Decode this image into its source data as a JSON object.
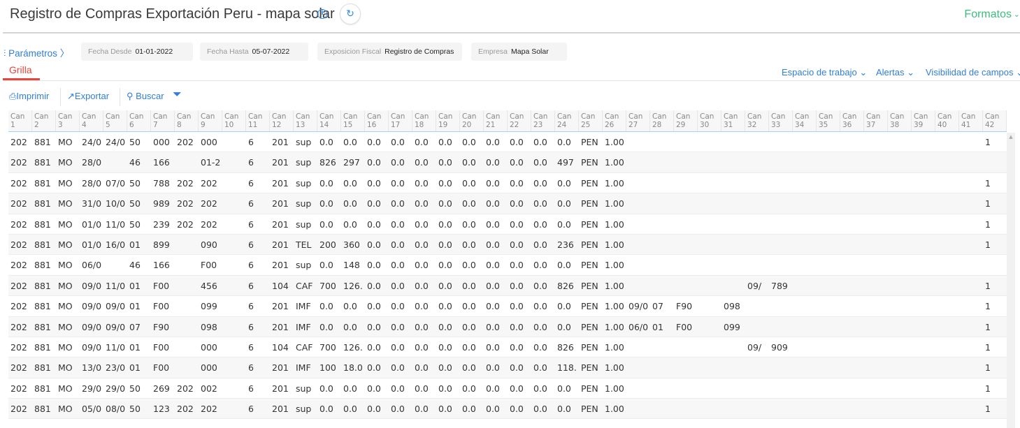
{
  "header": {
    "title": "Registro de Compras Exportación Peru - mapa solar",
    "formatos": "Formatos"
  },
  "params": {
    "label": "Parámetros",
    "chips": [
      {
        "key": "Fecha Desde",
        "value": "01-01-2022"
      },
      {
        "key": "Fecha Hasta",
        "value": "05-07-2022"
      },
      {
        "key": "Exposicion Fiscal",
        "value": "Registro de Compras"
      },
      {
        "key": "Empresa",
        "value": "Mapa Solar"
      }
    ]
  },
  "tabs": {
    "active": "Grilla"
  },
  "links": {
    "workspace": "Espacio de trabajo",
    "alerts": "Alertas",
    "visibility": "Visibilidad de campos"
  },
  "toolbar": {
    "print": "Imprimir",
    "export": "Exportar",
    "search": "Buscar"
  },
  "grid": {
    "header_prefix": "Can",
    "rows": [
      [
        "202",
        "881",
        "MO",
        "24/0",
        "24/0",
        "50",
        "000",
        "202",
        "000",
        "",
        "6",
        "201",
        "sup",
        "0.0",
        "0.0",
        "0.0",
        "0.0",
        "0.0",
        "0.0",
        "0.0",
        "0.0",
        "0.0",
        "0.0",
        "0.0",
        "PEN",
        "1.00",
        "",
        "",
        "",
        "",
        "",
        "",
        "",
        "",
        "",
        "",
        "",
        "",
        "",
        "",
        "",
        "1"
      ],
      [
        "202",
        "881",
        "MO",
        "28/0",
        "",
        "46",
        "166",
        "",
        "01-2",
        "",
        "6",
        "201",
        "sup",
        "826",
        "297",
        "0.0",
        "0.0",
        "0.0",
        "0.0",
        "0.0",
        "0.0",
        "0.0",
        "0.0",
        "497",
        "PEN",
        "1.00",
        "",
        "",
        "",
        "",
        "",
        "",
        "",
        "",
        "",
        "",
        "",
        "",
        "",
        "",
        "",
        ""
      ],
      [
        "202",
        "881",
        "MO",
        "28/0",
        "07/0",
        "50",
        "788",
        "202",
        "202",
        "",
        "6",
        "201",
        "sup",
        "0.0",
        "0.0",
        "0.0",
        "0.0",
        "0.0",
        "0.0",
        "0.0",
        "0.0",
        "0.0",
        "0.0",
        "0.0",
        "PEN",
        "1.00",
        "",
        "",
        "",
        "",
        "",
        "",
        "",
        "",
        "",
        "",
        "",
        "",
        "",
        "",
        "",
        "1"
      ],
      [
        "202",
        "881",
        "MO",
        "31/0",
        "10/0",
        "50",
        "989",
        "202",
        "202",
        "",
        "6",
        "201",
        "sup",
        "0.0",
        "0.0",
        "0.0",
        "0.0",
        "0.0",
        "0.0",
        "0.0",
        "0.0",
        "0.0",
        "0.0",
        "0.0",
        "PEN",
        "1.00",
        "",
        "",
        "",
        "",
        "",
        "",
        "",
        "",
        "",
        "",
        "",
        "",
        "",
        "",
        "",
        "1"
      ],
      [
        "202",
        "881",
        "MO",
        "01/0",
        "11/0",
        "50",
        "239",
        "202",
        "202",
        "",
        "6",
        "201",
        "sup",
        "0.0",
        "0.0",
        "0.0",
        "0.0",
        "0.0",
        "0.0",
        "0.0",
        "0.0",
        "0.0",
        "0.0",
        "0.0",
        "PEN",
        "1.00",
        "",
        "",
        "",
        "",
        "",
        "",
        "",
        "",
        "",
        "",
        "",
        "",
        "",
        "",
        "",
        "1"
      ],
      [
        "202",
        "881",
        "MO",
        "01/0",
        "16/0",
        "01",
        "899",
        "",
        "090",
        "",
        "6",
        "201",
        "TEL",
        "200",
        "360",
        "0.0",
        "0.0",
        "0.0",
        "0.0",
        "0.0",
        "0.0",
        "0.0",
        "0.0",
        "236",
        "PEN",
        "1.00",
        "",
        "",
        "",
        "",
        "",
        "",
        "",
        "",
        "",
        "",
        "",
        "",
        "",
        "",
        "",
        "1"
      ],
      [
        "202",
        "881",
        "MO",
        "06/0",
        "",
        "46",
        "166",
        "",
        "F00",
        "",
        "6",
        "201",
        "sup",
        "0.0",
        "148",
        "0.0",
        "0.0",
        "0.0",
        "0.0",
        "0.0",
        "0.0",
        "0.0",
        "0.0",
        "0.0",
        "PEN",
        "1.00",
        "",
        "",
        "",
        "",
        "",
        "",
        "",
        "",
        "",
        "",
        "",
        "",
        "",
        "",
        "",
        ""
      ],
      [
        "202",
        "881",
        "MO",
        "09/0",
        "11/0",
        "01",
        "F00",
        "",
        "456",
        "",
        "6",
        "104",
        "CAF",
        "700",
        "126.",
        "0.0",
        "0.0",
        "0.0",
        "0.0",
        "0.0",
        "0.0",
        "0.0",
        "0.0",
        "826",
        "PEN",
        "1.00",
        "",
        "",
        "",
        "",
        "",
        "09/",
        "789",
        "",
        "",
        "",
        "",
        "",
        "",
        "",
        "",
        "1"
      ],
      [
        "202",
        "881",
        "MO",
        "09/0",
        "09/0",
        "01",
        "F00",
        "",
        "099",
        "",
        "6",
        "201",
        "IMF",
        "0.0",
        "0.0",
        "0.0",
        "0.0",
        "0.0",
        "0.0",
        "0.0",
        "0.0",
        "0.0",
        "0.0",
        "0.0",
        "PEN",
        "1.00",
        "09/0",
        "07",
        "F90",
        "",
        "098",
        "",
        "",
        "",
        "",
        "",
        "",
        "",
        "",
        "",
        "",
        "1"
      ],
      [
        "202",
        "881",
        "MO",
        "09/0",
        "09/0",
        "07",
        "F90",
        "",
        "098",
        "",
        "6",
        "201",
        "IMF",
        "0.0",
        "0.0",
        "0.0",
        "0.0",
        "0.0",
        "0.0",
        "0.0",
        "0.0",
        "0.0",
        "0.0",
        "0.0",
        "PEN",
        "1.00",
        "06/0",
        "01",
        "F00",
        "",
        "099",
        "",
        "",
        "",
        "",
        "",
        "",
        "",
        "",
        "",
        "",
        "1"
      ],
      [
        "202",
        "881",
        "MO",
        "09/0",
        "11/0",
        "01",
        "F00",
        "",
        "000",
        "",
        "6",
        "104",
        "CAF",
        "700",
        "126.",
        "0.0",
        "0.0",
        "0.0",
        "0.0",
        "0.0",
        "0.0",
        "0.0",
        "0.0",
        "826",
        "PEN",
        "1.00",
        "",
        "",
        "",
        "",
        "",
        "09/",
        "909",
        "",
        "",
        "",
        "",
        "",
        "",
        "",
        "",
        "1"
      ],
      [
        "202",
        "881",
        "MO",
        "13/0",
        "23/0",
        "01",
        "F00",
        "",
        "000",
        "",
        "6",
        "201",
        "IMF",
        "100",
        "18.0",
        "0.0",
        "0.0",
        "0.0",
        "0.0",
        "0.0",
        "0.0",
        "0.0",
        "0.0",
        "118.",
        "PEN",
        "1.00",
        "",
        "",
        "",
        "",
        "",
        "",
        "",
        "",
        "",
        "",
        "",
        "",
        "",
        "",
        "",
        "1"
      ],
      [
        "202",
        "881",
        "MO",
        "29/0",
        "29/0",
        "50",
        "269",
        "202",
        "002",
        "",
        "6",
        "201",
        "sup",
        "0.0",
        "0.0",
        "0.0",
        "0.0",
        "0.0",
        "0.0",
        "0.0",
        "0.0",
        "0.0",
        "0.0",
        "0.0",
        "PEN",
        "1.00",
        "",
        "",
        "",
        "",
        "",
        "",
        "",
        "",
        "",
        "",
        "",
        "",
        "",
        "",
        "",
        "1"
      ],
      [
        "202",
        "881",
        "MO",
        "05/0",
        "08/0",
        "50",
        "123",
        "202",
        "202",
        "",
        "6",
        "201",
        "sup",
        "0.0",
        "0.0",
        "0.0",
        "0.0",
        "0.0",
        "0.0",
        "0.0",
        "0.0",
        "0.0",
        "0.0",
        "0.0",
        "PEN",
        "1.00",
        "",
        "",
        "",
        "",
        "",
        "",
        "",
        "",
        "",
        "",
        "",
        "",
        "",
        "",
        "",
        "1"
      ]
    ]
  }
}
